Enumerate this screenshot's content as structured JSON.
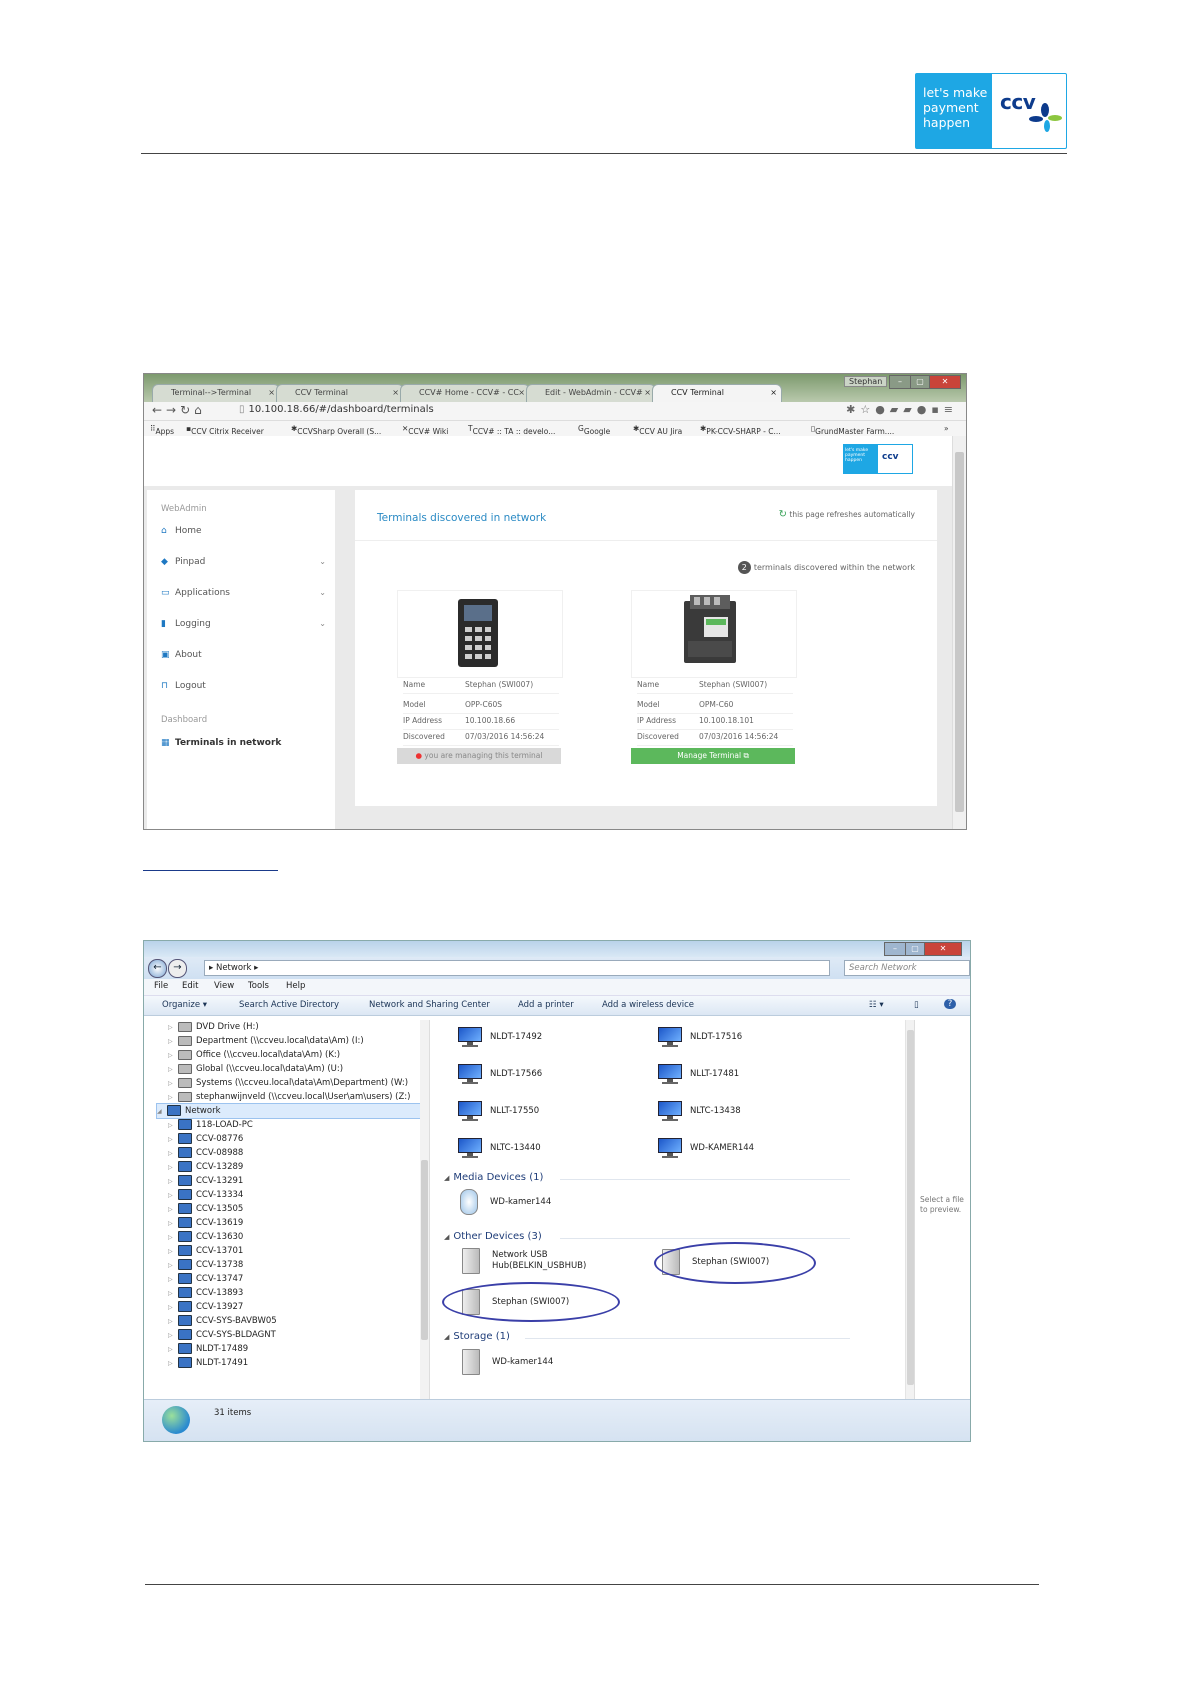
{
  "logo": {
    "slogan_line1": "let's make",
    "slogan_line2": "payment",
    "slogan_line3": "happen",
    "brand": "ccv"
  },
  "browser": {
    "tabs": [
      "Terminal-->Terminal",
      "CCV Terminal",
      "CCV# Home - CCV# - CC",
      "Edit - WebAdmin - CCV#",
      "CCV Terminal"
    ],
    "window_user": "Stephan",
    "url": "10.100.18.66/#/dashboard/terminals",
    "bookmarks": [
      "Apps",
      "CCV Citrix Receiver",
      "CCVSharp Overall (S...",
      "CCV# Wiki",
      "CCV# :: TA :: develo...",
      "Google",
      "CCV AU Jira",
      "PK-CCV-SHARP - C...",
      "GrundMaster Farm...."
    ],
    "mini_logo_slogan": "let's make payment happen",
    "mini_logo_brand": "ccv",
    "sidebar": {
      "section1": "WebAdmin",
      "items": [
        {
          "icon": "home-icon",
          "label": "Home"
        },
        {
          "icon": "layers-icon",
          "label": "Pinpad"
        },
        {
          "icon": "card-icon",
          "label": "Applications"
        },
        {
          "icon": "file-icon",
          "label": "Logging"
        },
        {
          "icon": "info-icon",
          "label": "About"
        },
        {
          "icon": "lock-icon",
          "label": "Logout"
        }
      ],
      "section2": "Dashboard",
      "active_item": "Terminals in network"
    },
    "main": {
      "title": "Terminals discovered in network",
      "refresh_note": "this page refreshes automatically",
      "count": "2",
      "count_text": "terminals discovered within the network",
      "terminals": [
        {
          "name_k": "Name",
          "name": "Stephan (SWI007)",
          "model_k": "Model",
          "model": "OPP-C60S",
          "ip_k": "IP Address",
          "ip": "10.100.18.66",
          "disc_k": "Discovered",
          "disc": "07/03/2016 14:56:24",
          "footer": "you are managing this terminal"
        },
        {
          "name_k": "Name",
          "name": "Stephan (SWI007)",
          "model_k": "Model",
          "model": "OPM-C60",
          "ip_k": "IP Address",
          "ip": "10.100.18.101",
          "disc_k": "Discovered",
          "disc": "07/03/2016 14:56:24",
          "footer": "Manage Terminal"
        }
      ]
    }
  },
  "explorer": {
    "path": "Network",
    "search_placeholder": "Search Network",
    "menu": [
      "File",
      "Edit",
      "View",
      "Tools",
      "Help"
    ],
    "commands": [
      "Organize ▾",
      "Search Active Directory",
      "Network and Sharing Center",
      "Add a printer",
      "Add a wireless device"
    ],
    "tree_drives": [
      "DVD Drive (H:)",
      "Department (\\\\ccveu.local\\data\\Am) (I:)",
      "Office (\\\\ccveu.local\\data\\Am) (K:)",
      "Global (\\\\ccveu.local\\data\\Am) (U:)",
      "Systems (\\\\ccveu.local\\data\\Am\\Department) (W:)",
      "stephanwijnveld (\\\\ccveu.local\\User\\am\\users) (Z:)"
    ],
    "tree_network": "Network",
    "tree_hosts": [
      "118-LOAD-PC",
      "CCV-08776",
      "CCV-08988",
      "CCV-13289",
      "CCV-13291",
      "CCV-13334",
      "CCV-13505",
      "CCV-13619",
      "CCV-13630",
      "CCV-13701",
      "CCV-13738",
      "CCV-13747",
      "CCV-13893",
      "CCV-13927",
      "CCV-SYS-BAVBW05",
      "CCV-SYS-BLDAGNT",
      "NLDT-17489",
      "NLDT-17491"
    ],
    "computers": [
      "NLDT-17492",
      "NLDT-17516",
      "NLDT-17566",
      "NLLT-17481",
      "NLLT-17550",
      "NLTC-13438",
      "NLTC-13440",
      "WD-KAMER144"
    ],
    "media_header": "Media Devices (1)",
    "media_item": "WD-kamer144",
    "other_header": "Other Devices (3)",
    "other_items": [
      "Network USB Hub(BELKIN_USBHUB)",
      "Stephan (SWI007)",
      "Stephan (SWI007)"
    ],
    "storage_header": "Storage (1)",
    "storage_item": "WD-kamer144",
    "preview_text": "Select a file to preview.",
    "status": "31 items"
  }
}
